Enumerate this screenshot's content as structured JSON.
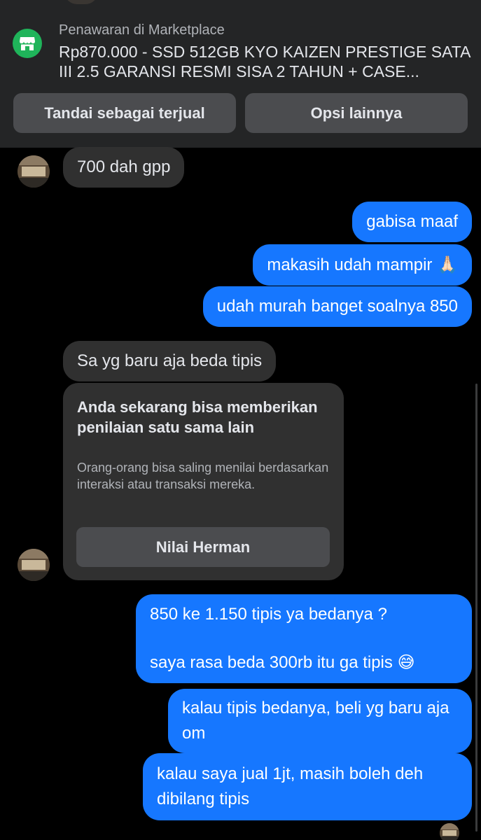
{
  "banner": {
    "kicker": "Penawaran di Marketplace",
    "title": "Rp870.000 - SSD 512GB KYO KAIZEN PRESTIGE SATA III 2.5 GARANSI RESMI SISA 2 TAHUN + CASE...",
    "mark_sold_label": "Tandai sebagai terjual",
    "more_options_label": "Opsi lainnya",
    "icon": "marketplace-shop-icon",
    "accent_color": "#1fb45a"
  },
  "messages": [
    {
      "from": "other",
      "text": "700 dah gpp"
    },
    {
      "from": "me",
      "text": "gabisa maaf"
    },
    {
      "from": "me",
      "text": "makasih udah mampir",
      "emoji": "🙏🏻"
    },
    {
      "from": "me",
      "text": "udah murah banget soalnya 850"
    },
    {
      "from": "other",
      "text": "Sa yg baru aja beda tipis"
    },
    {
      "from": "me",
      "text_line1": "850 ke 1.150 tipis ya bedanya ?",
      "text_line2": "saya rasa beda 300rb itu ga tipis",
      "emoji": "😅"
    },
    {
      "from": "me",
      "text": "kalau tipis bedanya, beli yg baru aja om"
    },
    {
      "from": "me",
      "text": "kalau saya jual 1jt, masih boleh deh dibilang tipis"
    }
  ],
  "rating_card": {
    "title": "Anda sekarang bisa memberikan penilaian satu sama lain",
    "description": "Orang-orang bisa saling menilai berdasarkan interaksi atau transaksi mereka.",
    "button_label": "Nilai Herman"
  },
  "colors": {
    "outgoing_bubble": "#1677ff",
    "incoming_bubble": "#303030",
    "banner_bg": "#242526"
  }
}
